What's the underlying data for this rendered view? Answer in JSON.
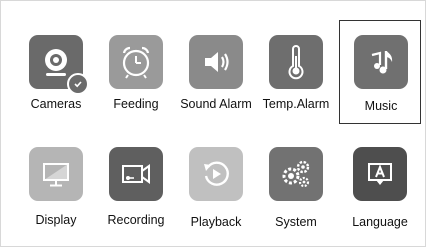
{
  "menu": {
    "items": [
      {
        "label": "Cameras",
        "icon": "camera-icon",
        "bg": "#6a6a6a",
        "checked": true
      },
      {
        "label": "Feeding",
        "icon": "alarm-clock-icon",
        "bg": "#9a9a9a"
      },
      {
        "label": "Sound Alarm",
        "icon": "speaker-icon",
        "bg": "#8a8a8a"
      },
      {
        "label": "Temp.Alarm",
        "icon": "thermometer-icon",
        "bg": "#6e6e6e"
      },
      {
        "label": "Music",
        "icon": "music-note-icon",
        "bg": "#707070",
        "selected": true
      },
      {
        "label": "Display",
        "icon": "monitor-icon",
        "bg": "#b5b5b5"
      },
      {
        "label": "Recording",
        "icon": "video-camera-icon",
        "bg": "#5f5f5f"
      },
      {
        "label": "Playback",
        "icon": "playback-icon",
        "bg": "#c0c0c0"
      },
      {
        "label": "System",
        "icon": "settings-gears-icon",
        "bg": "#727272"
      },
      {
        "label": "Language",
        "icon": "language-icon",
        "bg": "#4e4e4e"
      }
    ]
  }
}
